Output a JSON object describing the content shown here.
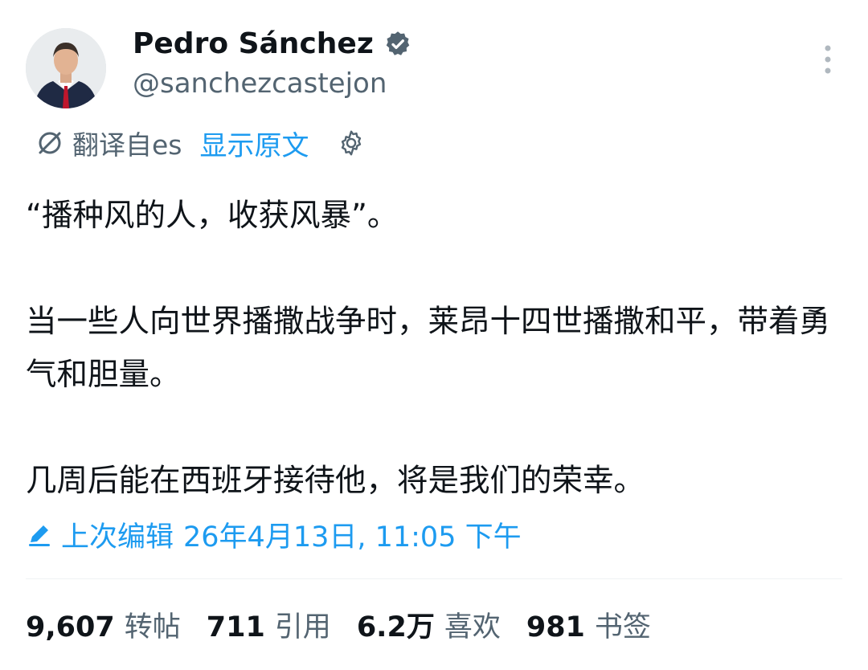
{
  "author": {
    "display_name": "Pedro Sánchez",
    "handle": "@sanchezcastejon",
    "verified": true,
    "verified_color": "#536471"
  },
  "translation": {
    "label": "翻译自es",
    "show_original": "显示原文"
  },
  "tweet": {
    "paragraphs": [
      "“播种风的人，收获风暴”。",
      "当一些人向世界播撒战争时，莱昂十四世播撒和平，带着勇气和胆量。",
      "几周后能在西班牙接待他，将是我们的荣幸。"
    ]
  },
  "edited": {
    "label": "上次编辑",
    "timestamp": "26年4月13日, 11:05 下午"
  },
  "stats": [
    {
      "value": "9,607",
      "label": "转帖"
    },
    {
      "value": "711",
      "label": "引用"
    },
    {
      "value": "6.2万",
      "label": "喜欢"
    },
    {
      "value": "981",
      "label": "书签"
    }
  ],
  "colors": {
    "accent": "#1d9bf0",
    "secondary_text": "#536471",
    "primary_text": "#0f1419"
  },
  "icons": {
    "more": "more-vertical-icon",
    "translate": "translate-icon",
    "settings": "gear-icon",
    "edit": "pencil-icon",
    "verified": "verified-badge-icon"
  }
}
